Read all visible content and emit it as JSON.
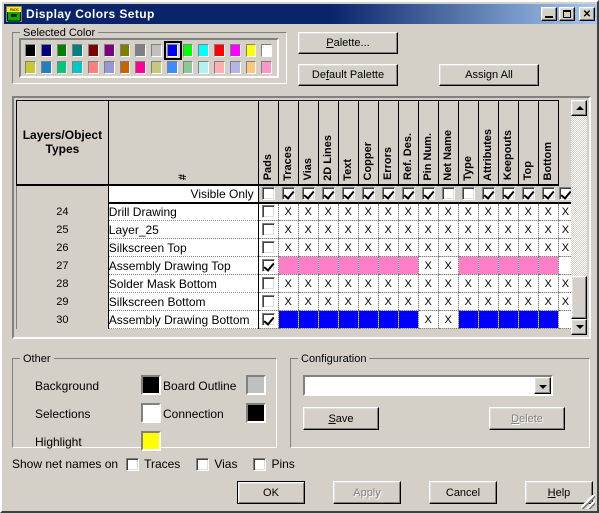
{
  "window": {
    "title": "Display Colors Setup",
    "icon": "pads-app-icon",
    "buttons": {
      "minimize": "_",
      "maximize": "□",
      "close": "✕"
    }
  },
  "selected_color": {
    "legend": "Selected Color",
    "selected_index": 9,
    "row1": [
      "#000000",
      "#000080",
      "#008000",
      "#008080",
      "#800000",
      "#800080",
      "#808000",
      "#808080",
      "#c0c0c0",
      "#0000ff",
      "#00ff00",
      "#00ffff",
      "#ff0000",
      "#ff00ff",
      "#ffff00",
      "#ffffff"
    ],
    "row2": [
      "#c8c832",
      "#1f7fc0",
      "#00c878",
      "#00c8c8",
      "#ff7f7f",
      "#9696dc",
      "#c86400",
      "#ff0096",
      "#c8c878",
      "#3c8cff",
      "#8cc896",
      "#b4f0f0",
      "#ffafaf",
      "#b4b4e6",
      "#ffc878",
      "#ff96c8"
    ]
  },
  "toolbar": {
    "palette_label": "Palette...",
    "palette_accel": "P",
    "default_palette_label": "Default Palette",
    "default_palette_accel": "f",
    "assign_all_label": "Assign All"
  },
  "table": {
    "main_header": "Layers/Object Types",
    "columns": [
      "#",
      "Pads",
      "Traces",
      "Vias",
      "2D Lines",
      "Text",
      "Copper",
      "Errors",
      "Ref. Des.",
      "Pin Num.",
      "Net Name",
      "Type",
      "Attributes",
      "Keepouts",
      "Top",
      "Bottom"
    ],
    "visible_only_label": "Visible Only",
    "visible_only_checks": [
      false,
      true,
      true,
      true,
      true,
      true,
      true,
      true,
      true,
      false,
      false,
      true,
      true,
      true,
      true,
      true
    ],
    "mark": "X",
    "rows": [
      {
        "num": "24",
        "name": "Drill Drawing",
        "checked": false,
        "color": null,
        "cells": [
          "X",
          "X",
          "X",
          "X",
          "X",
          "X",
          "X",
          "X",
          "X",
          "X",
          "X",
          "X",
          "X",
          "X",
          "X"
        ]
      },
      {
        "num": "25",
        "name": "Layer_25",
        "checked": false,
        "color": null,
        "cells": [
          "X",
          "X",
          "X",
          "X",
          "X",
          "X",
          "X",
          "X",
          "X",
          "X",
          "X",
          "X",
          "X",
          "X",
          "X"
        ]
      },
      {
        "num": "26",
        "name": "Silkscreen Top",
        "checked": false,
        "color": null,
        "cells": [
          "X",
          "X",
          "X",
          "X",
          "X",
          "X",
          "X",
          "X",
          "X",
          "X",
          "X",
          "X",
          "X",
          "X",
          "X"
        ]
      },
      {
        "num": "27",
        "name": "Assembly Drawing Top",
        "checked": true,
        "color": "#ff7ec8",
        "cells": [
          "#ff7ec8",
          "#ff7ec8",
          "#ff7ec8",
          "#ff7ec8",
          "#ff7ec8",
          "#ff7ec8",
          "#ff7ec8",
          "X",
          "X",
          "#ff7ec8",
          "#ff7ec8",
          "#ff7ec8",
          "#ff7ec8",
          "#ff7ec8",
          ""
        ]
      },
      {
        "num": "28",
        "name": "Solder Mask Bottom",
        "checked": false,
        "color": null,
        "cells": [
          "X",
          "X",
          "X",
          "X",
          "X",
          "X",
          "X",
          "X",
          "X",
          "X",
          "X",
          "X",
          "X",
          "X",
          "X"
        ]
      },
      {
        "num": "29",
        "name": "Silkscreen Bottom",
        "checked": false,
        "color": null,
        "cells": [
          "X",
          "X",
          "X",
          "X",
          "X",
          "X",
          "X",
          "X",
          "X",
          "X",
          "X",
          "X",
          "X",
          "X",
          "X"
        ]
      },
      {
        "num": "30",
        "name": "Assembly Drawing Bottom",
        "checked": true,
        "color": "#0000ff",
        "cells": [
          "#0000ff",
          "#0000ff",
          "#0000ff",
          "#0000ff",
          "#0000ff",
          "#0000ff",
          "#0000ff",
          "X",
          "X",
          "#0000ff",
          "#0000ff",
          "#0000ff",
          "#0000ff",
          "#0000ff",
          ""
        ]
      }
    ]
  },
  "other": {
    "legend": "Other",
    "items": [
      {
        "label": "Background",
        "color": "#000000"
      },
      {
        "label": "Selections",
        "color": "#ffffff"
      },
      {
        "label": "Highlight",
        "color": "#ffff00"
      },
      {
        "label": "Board Outline",
        "color": "#c0c0c0"
      },
      {
        "label": "Connection",
        "color": "#000000"
      }
    ]
  },
  "configuration": {
    "legend": "Configuration",
    "combo_value": "",
    "combo_placeholder": "",
    "save_label": "Save",
    "save_accel": "S",
    "delete_label": "Delete",
    "delete_accel": "D",
    "delete_enabled": false
  },
  "net_names": {
    "label": "Show net names on",
    "options": [
      {
        "label": "Traces",
        "checked": false
      },
      {
        "label": "Vias",
        "checked": false
      },
      {
        "label": "Pins",
        "checked": false
      }
    ]
  },
  "footer": {
    "ok_label": "OK",
    "apply_label": "Apply",
    "apply_enabled": false,
    "cancel_label": "Cancel",
    "help_label": "Help",
    "help_accel": "H"
  }
}
